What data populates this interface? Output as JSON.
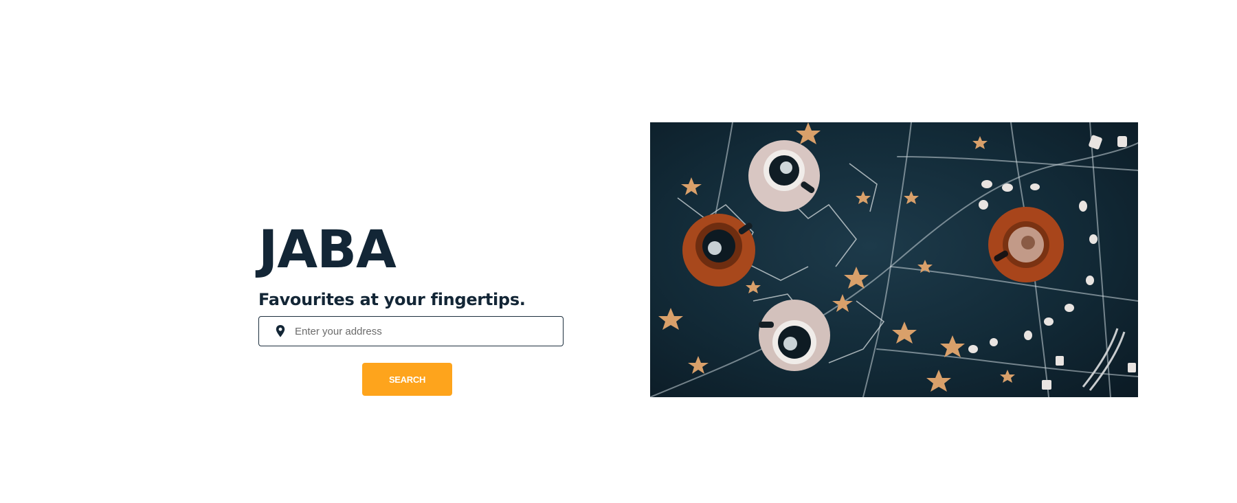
{
  "hero": {
    "brand": "JABA",
    "tagline": "Favourites at your fingertips.",
    "address_placeholder": "Enter your address",
    "address_value": "",
    "search_label": "SEARCH",
    "pin_icon": "location-pin-icon"
  },
  "colors": {
    "text_dark": "#132636",
    "accent": "#fea41c",
    "image_bg": "#122a37"
  }
}
